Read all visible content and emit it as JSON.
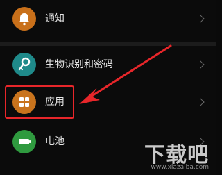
{
  "settings": {
    "items": [
      {
        "label": "通知",
        "icon": "bell-icon",
        "color": "#c9701a"
      },
      {
        "label": "生物识别和密码",
        "icon": "key-icon",
        "color": "#1f8a8a"
      },
      {
        "label": "应用",
        "icon": "apps-grid-icon",
        "color": "#c9741d"
      },
      {
        "label": "电池",
        "icon": "battery-icon",
        "color": "#2f9a3f"
      }
    ]
  },
  "annotation": {
    "highlight_color": "#e8262a"
  },
  "watermark": {
    "text": "下载吧",
    "url": "www.xiazaiba.com"
  }
}
